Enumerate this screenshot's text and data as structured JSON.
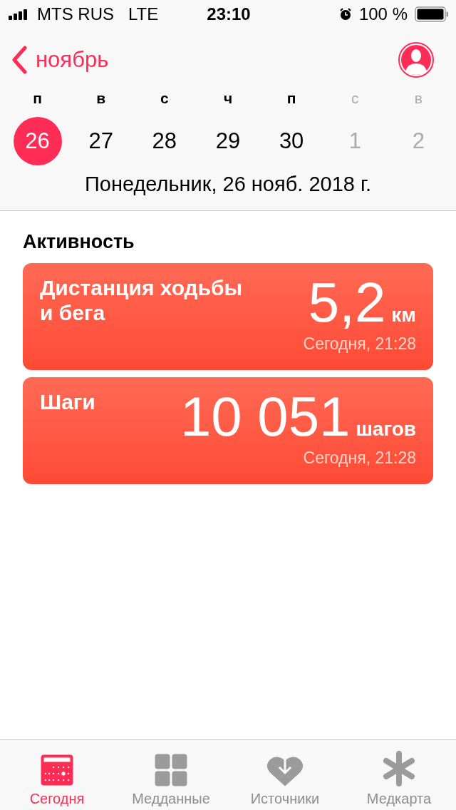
{
  "status_bar": {
    "carrier": "MTS RUS",
    "network": "LTE",
    "time": "23:10",
    "battery": "100 %"
  },
  "nav": {
    "back": "ноябрь"
  },
  "week": [
    {
      "weekday": "п",
      "day": "26",
      "selected": true,
      "dimmed": false
    },
    {
      "weekday": "в",
      "day": "27",
      "selected": false,
      "dimmed": false
    },
    {
      "weekday": "с",
      "day": "28",
      "selected": false,
      "dimmed": false
    },
    {
      "weekday": "ч",
      "day": "29",
      "selected": false,
      "dimmed": false
    },
    {
      "weekday": "п",
      "day": "30",
      "selected": false,
      "dimmed": false
    },
    {
      "weekday": "с",
      "day": "1",
      "selected": false,
      "dimmed": true
    },
    {
      "weekday": "в",
      "day": "2",
      "selected": false,
      "dimmed": true
    }
  ],
  "date_title": "Понедельник, 26 нояб. 2018 г.",
  "section_title": "Активность",
  "cards": [
    {
      "title": "Дистанция ходьбы и бега",
      "value": "5,2",
      "unit": "км",
      "time": "Сегодня, 21:28"
    },
    {
      "title": "Шаги",
      "value": "10 051",
      "unit": "шагов",
      "time": "Сегодня, 21:28"
    }
  ],
  "tab_bar": [
    {
      "kind": "today",
      "label": "Сегодня",
      "selected": true
    },
    {
      "kind": "data",
      "label": "Медданные",
      "selected": false
    },
    {
      "kind": "sources",
      "label": "Источники",
      "selected": false
    },
    {
      "kind": "medical",
      "label": "Медкарта",
      "selected": false
    }
  ]
}
